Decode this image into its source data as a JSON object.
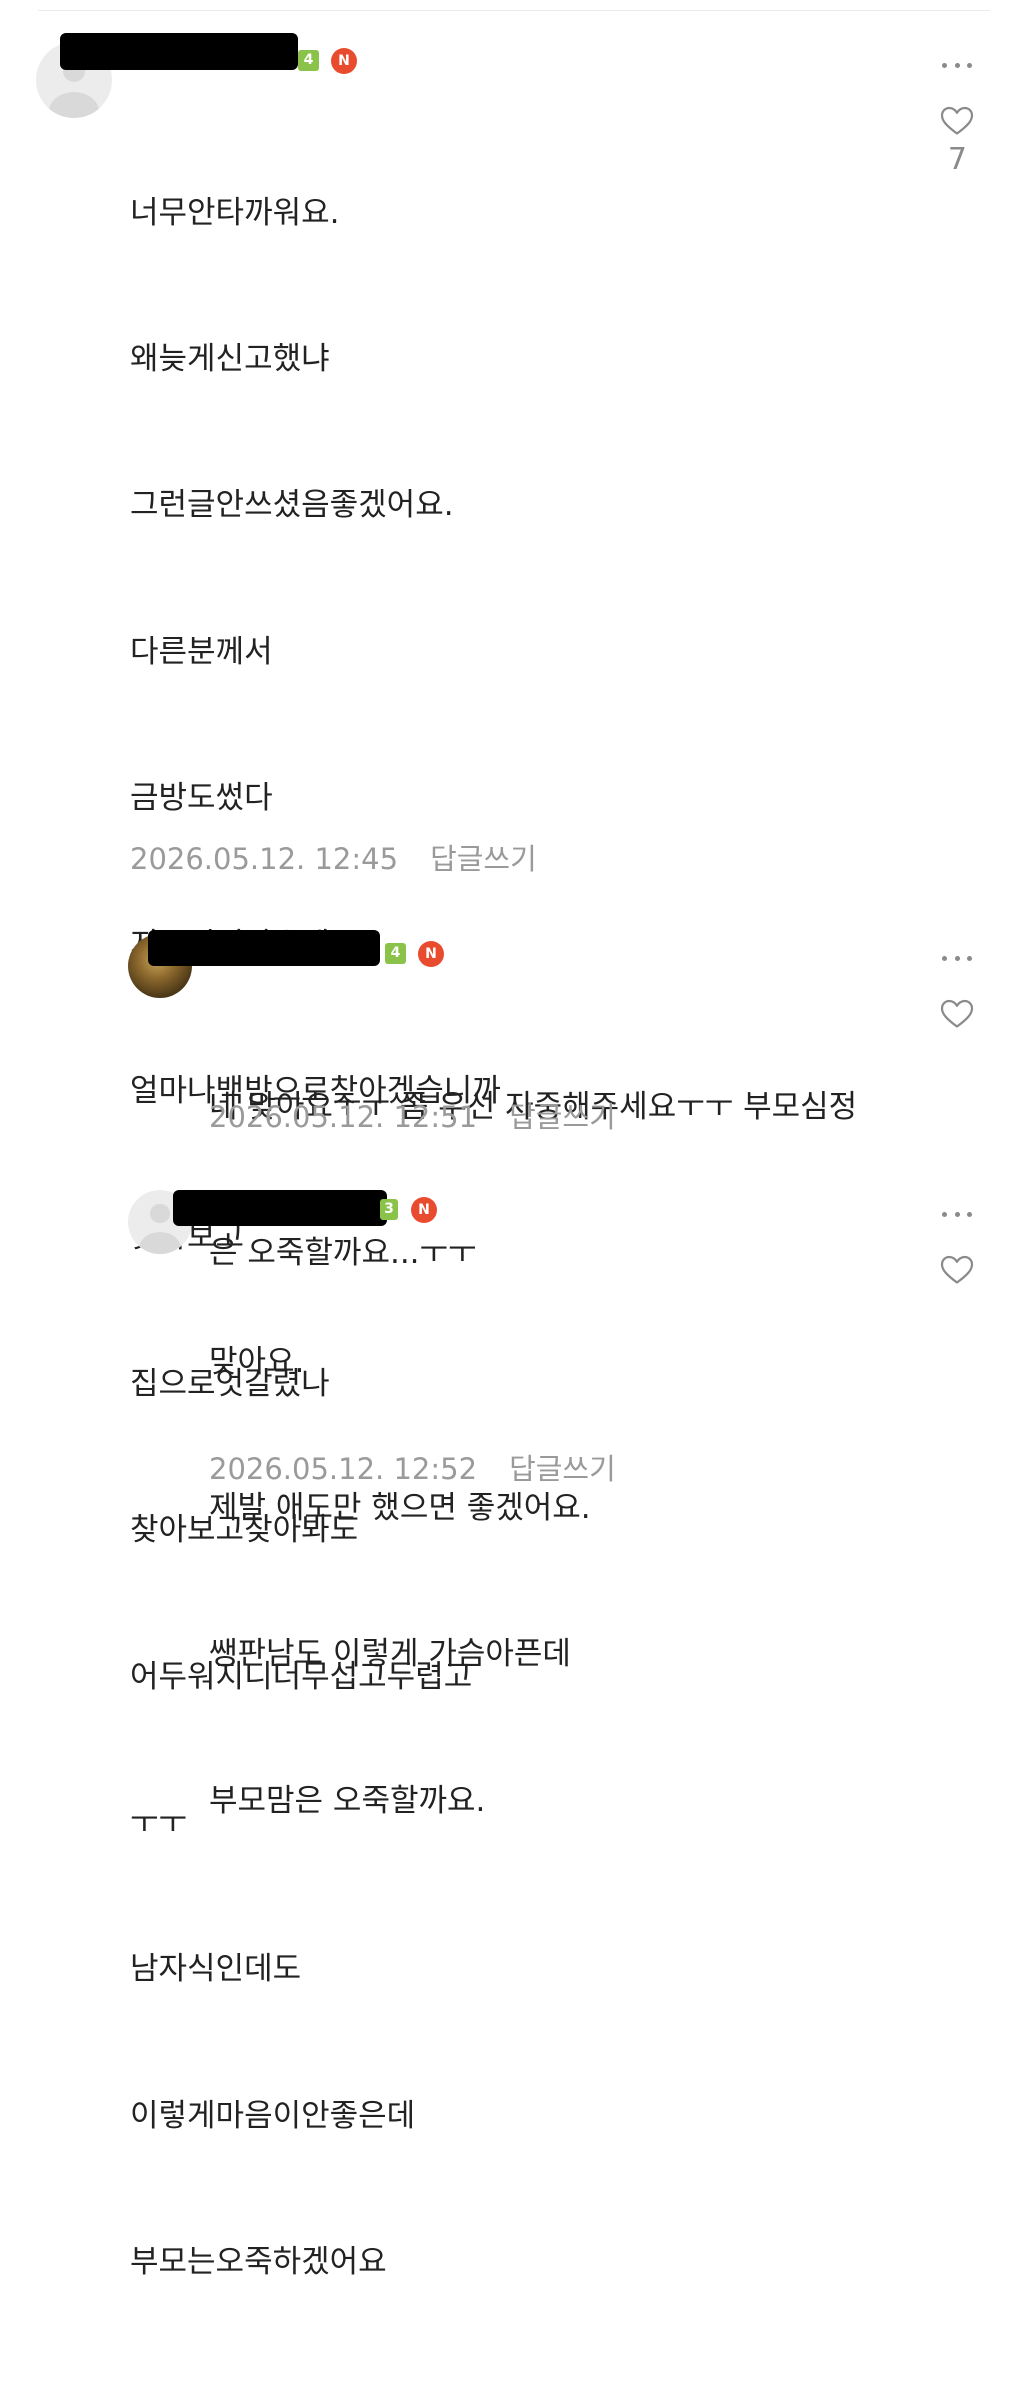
{
  "comments": [
    {
      "level_badge": "4",
      "new_badge": "N",
      "lines": [
        "너무안타까워요.",
        "왜늦게신고했냐",
        "그런글안쓰셨음좋겠어요.",
        "다른분께서",
        "금방도썼다",
        "지우신거같은데..",
        "얼마나백방으로찾아겠습니까",
        "찾아보고",
        "집으로엇갈렸나",
        "찾아보고찾아봐도",
        "어두워지니더무섭고두렵고",
        "ㅜㅜ",
        "남자식인데도",
        "이렇게마음이안좋은데",
        "부모는오죽하겠어요"
      ],
      "timestamp": "2026.05.12. 12:45",
      "reply_label": "답글쓰기",
      "like_count": "7"
    },
    {
      "level_badge": "4",
      "new_badge": "N",
      "lines": [
        "네 맞아요ㅜㅜ 좀 우선 자중해주세요ㅜㅜ 부모심정",
        "은 오죽할까요...ㅜㅜ"
      ],
      "timestamp": "2026.05.12. 12:51",
      "reply_label": "답글쓰기"
    },
    {
      "level_badge": "3",
      "new_badge": "N",
      "lines": [
        "맞아요.",
        "제발 애도만 했으면 좋겠어요.",
        "쌩판남도 이렇게 가슴아픈데",
        "부모맘은 오죽할까요."
      ],
      "timestamp": "2026.05.12. 12:52",
      "reply_label": "답글쓰기"
    }
  ],
  "colors": {
    "level_badge": "#8bc34a",
    "new_badge": "#e94b2e",
    "meta_text": "#9a9a9a",
    "body_text": "#222222",
    "redaction": "#000000"
  },
  "icons": {
    "more": "more-dots-icon",
    "like": "heart-outline-icon",
    "avatar_default": "default-user-icon"
  }
}
